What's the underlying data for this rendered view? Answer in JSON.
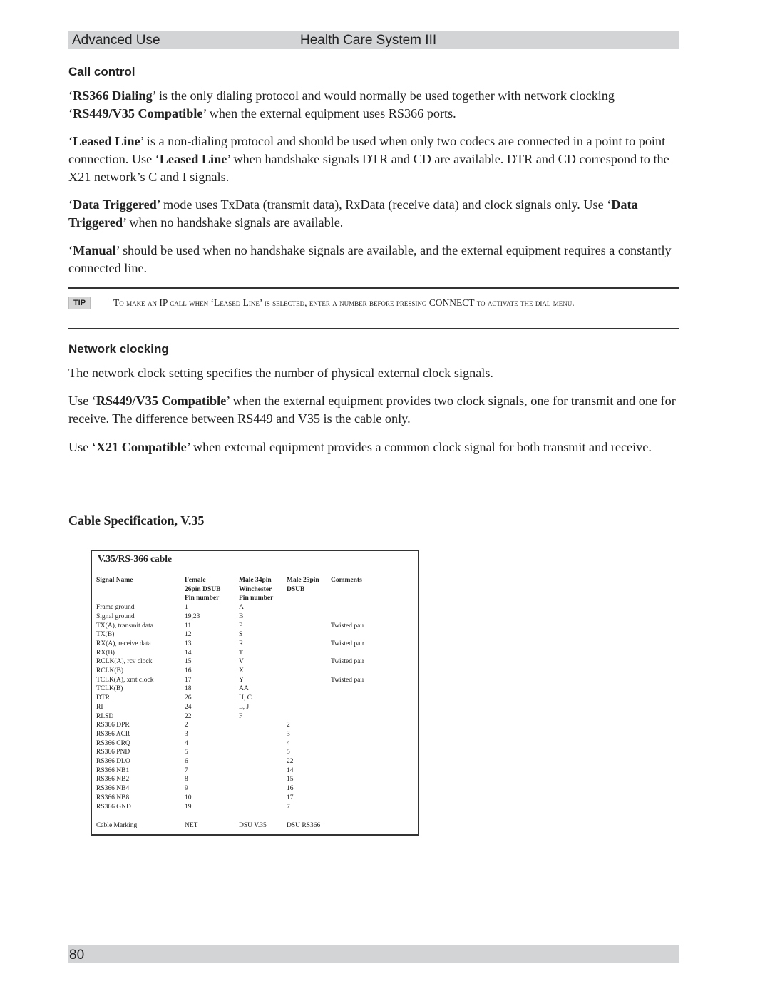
{
  "header": {
    "section": "Advanced Use",
    "product": "Health Care System III"
  },
  "call_control": {
    "heading": "Call control",
    "paragraphs": [
      [
        {
          "t": "‘",
          "b": false
        },
        {
          "t": "RS366 Dialing",
          "b": true
        },
        {
          "t": "’ is the only dialing protocol and would normally be used together with network clocking ‘",
          "b": false
        },
        {
          "t": "RS449/V35 Compatible",
          "b": true
        },
        {
          "t": "’ when the external equipment uses RS366 ports.",
          "b": false
        }
      ],
      [
        {
          "t": "‘",
          "b": false
        },
        {
          "t": "Leased Line",
          "b": true
        },
        {
          "t": "’ is a non-dialing protocol and should be used when only two codecs are connected in a point to point connection. Use ‘",
          "b": false
        },
        {
          "t": "Leased Line",
          "b": true
        },
        {
          "t": "’ when handshake signals DTR and CD are available. DTR and CD correspond to the X21 network’s C and I signals.",
          "b": false
        }
      ],
      [
        {
          "t": "‘",
          "b": false
        },
        {
          "t": "Data Triggered",
          "b": true
        },
        {
          "t": "’ mode uses TxData (transmit data), RxData (receive data) and clock signals only. Use ‘",
          "b": false
        },
        {
          "t": "Data Triggered",
          "b": true
        },
        {
          "t": "’ when no handshake signals are available.",
          "b": false
        }
      ],
      [
        {
          "t": "‘",
          "b": false
        },
        {
          "t": "Manual",
          "b": true
        },
        {
          "t": "’ should be used when no handshake signals are available, and the external equipment requires a constantly connected line.",
          "b": false
        }
      ]
    ]
  },
  "tip": {
    "badge": "TIP",
    "text": "To make an IP call when ‘Leased Line’ is selected, enter a number before pressing CONNECT to activate the dial menu."
  },
  "network_clocking": {
    "heading": "Network clocking",
    "paragraphs": [
      [
        {
          "t": "The network clock setting specifies the number of physical external clock signals.",
          "b": false
        }
      ],
      [
        {
          "t": "Use ‘",
          "b": false
        },
        {
          "t": "RS449/V35 Compatible",
          "b": true
        },
        {
          "t": "’ when the external equipment provides two clock signals, one for transmit and one for receive. The difference between RS449 and V35 is the cable only.",
          "b": false
        }
      ],
      [
        {
          "t": "Use ‘",
          "b": false
        },
        {
          "t": "X21 Compatible",
          "b": true
        },
        {
          "t": "’ when external equipment provides a common clock signal for both transmit and receive.",
          "b": false
        }
      ]
    ]
  },
  "cable_spec": {
    "heading": "Cable Specification, V.35",
    "table_title": "V.35/RS-366 cable",
    "columns": [
      [
        "Signal Name"
      ],
      [
        "Female",
        "26pin DSUB",
        "Pin number"
      ],
      [
        "Male 34pin",
        "Winchester",
        "Pin number"
      ],
      [
        "Male 25pin",
        "DSUB"
      ],
      [
        "Comments"
      ]
    ],
    "rows": [
      [
        "Frame ground",
        "1",
        "A",
        "",
        ""
      ],
      [
        "Signal ground",
        "19,23",
        "B",
        "",
        ""
      ],
      [
        "TX(A), transmit data",
        "11",
        "P",
        "",
        "Twisted pair"
      ],
      [
        "TX(B)",
        "12",
        "S",
        "",
        ""
      ],
      [
        "RX(A), receive data",
        "13",
        "R",
        "",
        "Twisted pair"
      ],
      [
        "RX(B)",
        "14",
        "T",
        "",
        ""
      ],
      [
        "RCLK(A), rcv clock",
        "15",
        "V",
        "",
        "Twisted pair"
      ],
      [
        "RCLK(B)",
        "16",
        "X",
        "",
        ""
      ],
      [
        "TCLK(A), xmt clock",
        "17",
        "Y",
        "",
        "Twisted pair"
      ],
      [
        "TCLK(B)",
        "18",
        "AA",
        "",
        ""
      ],
      [
        "DTR",
        "26",
        "H, C",
        "",
        ""
      ],
      [
        "RI",
        "24",
        "L, J",
        "",
        ""
      ],
      [
        "RLSD",
        "22",
        "F",
        "",
        ""
      ],
      [
        "RS366 DPR",
        "2",
        "",
        "2",
        ""
      ],
      [
        "RS366 ACR",
        "3",
        "",
        "3",
        ""
      ],
      [
        "RS366 CRQ",
        "4",
        "",
        "4",
        ""
      ],
      [
        "RS366 PND",
        "5",
        "",
        "5",
        ""
      ],
      [
        "RS366 DLO",
        "6",
        "",
        "22",
        ""
      ],
      [
        "RS366 NB1",
        "7",
        "",
        "14",
        ""
      ],
      [
        "RS366 NB2",
        "8",
        "",
        "15",
        ""
      ],
      [
        "RS366 NB4",
        "9",
        "",
        "16",
        ""
      ],
      [
        "RS366 NB8",
        "10",
        "",
        "17",
        ""
      ],
      [
        "RS366 GND",
        "19",
        "",
        "7",
        ""
      ]
    ],
    "marking_row": [
      "Cable Marking",
      "NET",
      "DSU V.35",
      "DSU RS366",
      ""
    ]
  },
  "footer": {
    "page_number": "80"
  }
}
